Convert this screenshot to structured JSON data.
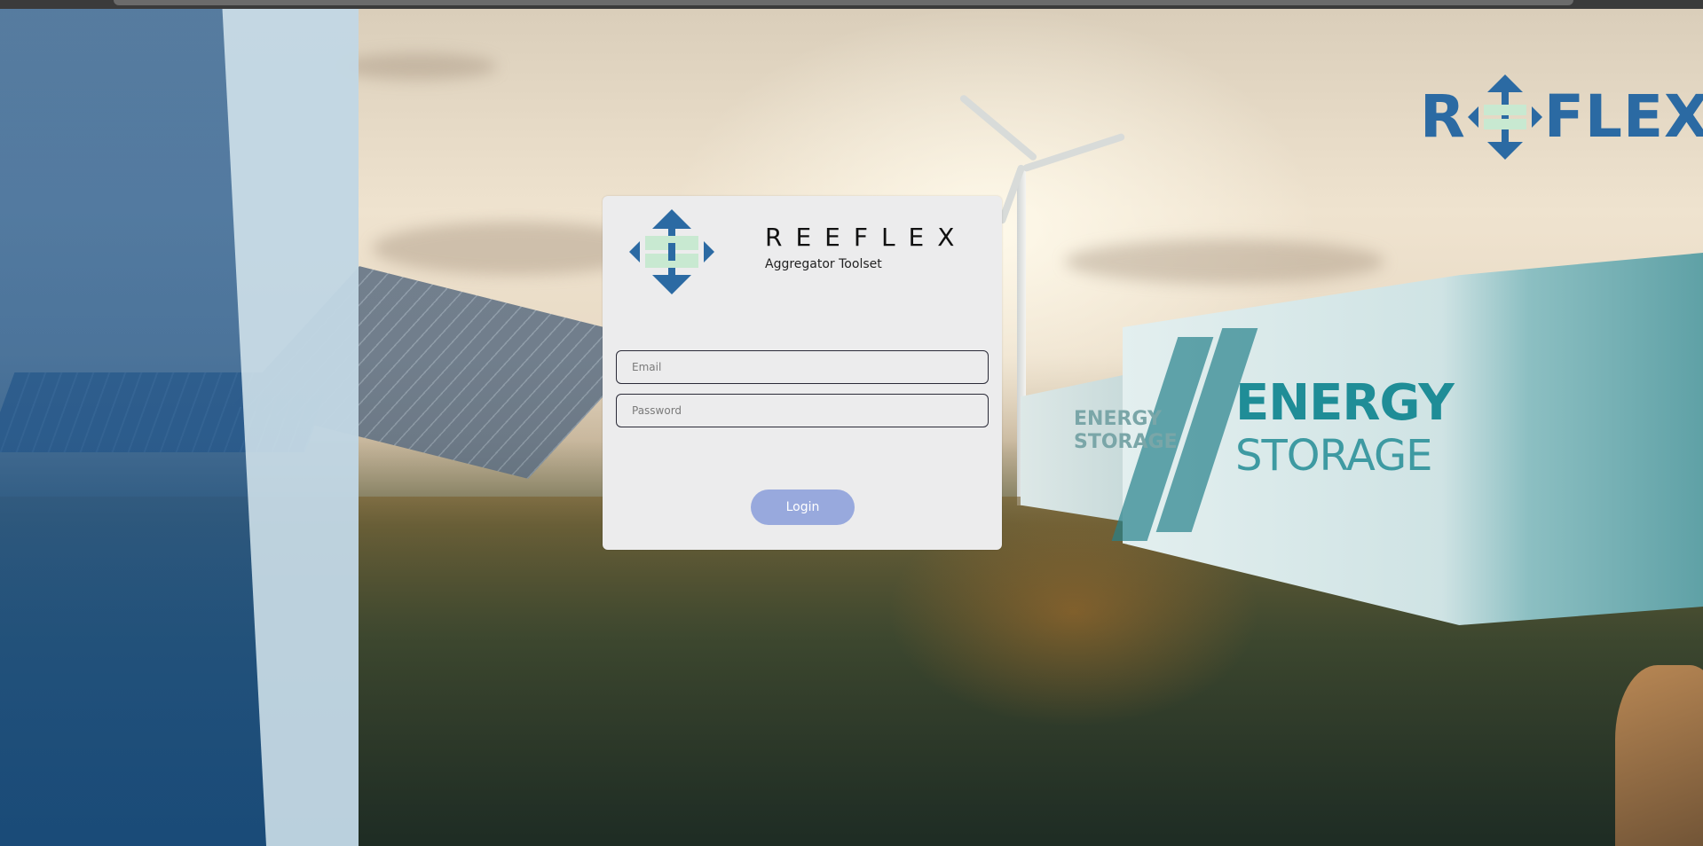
{
  "brand": {
    "name": "REEFLEX",
    "subtitle": "Aggregator Toolset",
    "top_logo_left": "R",
    "top_logo_right": "FLEX"
  },
  "login": {
    "email_placeholder": "Email",
    "password_placeholder": "Password",
    "button_label": "Login"
  },
  "background": {
    "energy_label": "ENERGY",
    "storage_label": "STORAGE",
    "energy_small": "ENERGY",
    "storage_small": "STORAGE"
  },
  "colors": {
    "brand_blue": "#2b6aa3",
    "brand_green": "#c8e9d1",
    "card_bg": "#ececed",
    "button_bg": "#98a9dd"
  },
  "icons": {
    "logo": "reeflex-arrows-icon"
  }
}
